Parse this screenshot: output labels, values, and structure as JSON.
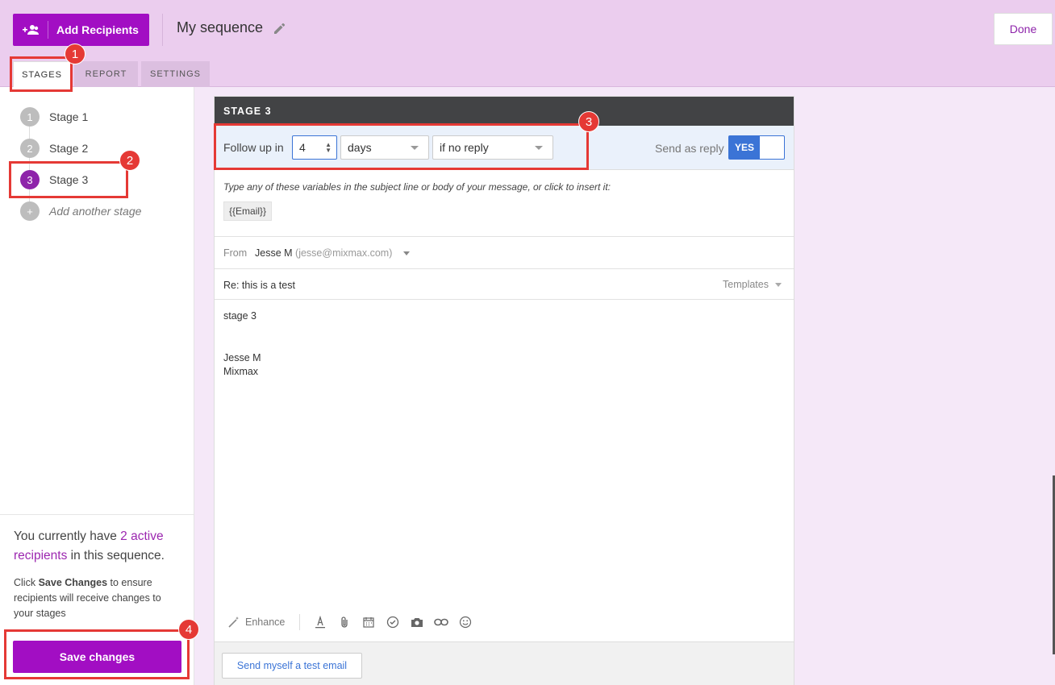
{
  "header": {
    "add_recipients_label": "Add Recipients",
    "sequence_title": "My sequence",
    "done_label": "Done",
    "tabs": [
      {
        "label": "STAGES",
        "active": true
      },
      {
        "label": "REPORT",
        "active": false
      },
      {
        "label": "SETTINGS",
        "active": false
      }
    ]
  },
  "sidebar": {
    "stages": [
      {
        "num": "1",
        "label": "Stage 1",
        "active": false
      },
      {
        "num": "2",
        "label": "Stage 2",
        "active": false
      },
      {
        "num": "3",
        "label": "Stage 3",
        "active": true
      }
    ],
    "add_stage_label": "Add another stage",
    "add_stage_icon": "+",
    "active_text_pre": "You currently have",
    "active_link": "2 active recipients",
    "active_text_post": "in this sequence.",
    "help_pre": "Click",
    "help_bold": "Save Changes",
    "help_post": "to ensure recipients will receive changes to your stages",
    "save_label": "Save changes"
  },
  "panel": {
    "title": "STAGE 3",
    "follow_up_label": "Follow up in",
    "follow_up_value": "4",
    "unit_select": "days",
    "condition_select": "if no reply",
    "send_as_reply_label": "Send as reply",
    "send_as_reply_toggle": "YES",
    "vars_hint": "Type any of these variables in the subject line or body of your message, or click to insert it:",
    "var_chip": "{{Email}}",
    "from_label": "From",
    "from_name": "Jesse M",
    "from_email": "(jesse@mixmax.com)",
    "subject": "Re: this is a test",
    "templates_label": "Templates",
    "body_line1": "stage 3",
    "body_sig1": "Jesse M",
    "body_sig2": "Mixmax",
    "enhance_label": "Enhance",
    "test_email_label": "Send myself a test email"
  },
  "annotations": [
    "1",
    "2",
    "3",
    "4"
  ],
  "colors": {
    "brand_purple": "#a20ec3",
    "header_bg": "#ebcdee",
    "accent_blue": "#3b74d6",
    "annotation_red": "#e53935"
  }
}
